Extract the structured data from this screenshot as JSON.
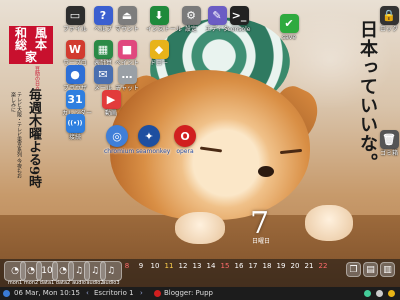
{
  "brand": {
    "title_chars": [
      "和",
      "風",
      "総",
      "本",
      "家"
    ],
    "subtitle": "豆助の日々",
    "schedule": "毎週木曜よる9時",
    "schedule_sub": "テレビ大阪・テレビ東京系列 今夜もお楽しみに"
  },
  "tagline": "日本っていいな。",
  "desktop_icons": [
    {
      "name": "file",
      "label": "ファイル",
      "glyph": "▭",
      "color": "#2d2d2d"
    },
    {
      "name": "help",
      "label": "ヘルプ",
      "glyph": "?",
      "color": "#3b5fd0"
    },
    {
      "name": "mount",
      "label": "マウント",
      "glyph": "⏏",
      "color": "#7d7d7d"
    },
    {
      "name": "install",
      "label": "インストール",
      "glyph": "⬇",
      "color": "#1f8a3b"
    },
    {
      "name": "settings",
      "label": "設定",
      "glyph": "⚙",
      "color": "#7a7a7a"
    },
    {
      "name": "editor",
      "label": "エディタ",
      "glyph": "✎",
      "color": "#6b5cc4"
    },
    {
      "name": "console",
      "label": "console",
      "glyph": ">_",
      "color": "#222"
    },
    {
      "name": "save",
      "label": "save",
      "glyph": "✔",
      "color": "#2faa3f"
    },
    {
      "name": "lock",
      "label": "ロック",
      "glyph": "🔒",
      "color": "#333"
    },
    {
      "name": "wordpro",
      "label": "ワープロ",
      "glyph": "W",
      "color": "#d23b2f"
    },
    {
      "name": "spreadsheet",
      "label": "表計算",
      "glyph": "▦",
      "color": "#2b8a46"
    },
    {
      "name": "paint",
      "label": "ペイント",
      "glyph": "■",
      "color": "#e0487e"
    },
    {
      "name": "draw",
      "label": "ドロー",
      "glyph": "◆",
      "color": "#e8b31a"
    },
    {
      "name": "browser",
      "label": "ブラウザ",
      "glyph": "●",
      "color": "#2e6fd6"
    },
    {
      "name": "mail",
      "label": "メール",
      "glyph": "✉",
      "color": "#4a6fb0"
    },
    {
      "name": "chat",
      "label": "チャット",
      "glyph": "…",
      "color": "#9aa0a6"
    },
    {
      "name": "calendar",
      "label": "カレンダー",
      "glyph": "31",
      "color": "#2f7fe0"
    },
    {
      "name": "video",
      "label": "動画",
      "glyph": "▶",
      "color": "#e23b3b"
    },
    {
      "name": "network",
      "label": "接続",
      "glyph": "((•))",
      "color": "#2f7fe0"
    },
    {
      "name": "chromium",
      "label": "chromium",
      "glyph": "◎",
      "color": "#3f7fd8"
    },
    {
      "name": "seamonkey",
      "label": "seamonkey",
      "glyph": "✦",
      "color": "#1e4fa0"
    },
    {
      "name": "opera",
      "label": "opera",
      "glyph": "O",
      "color": "#d11f1f"
    },
    {
      "name": "trash",
      "label": "ゴミ箱",
      "glyph": "🗑",
      "color": "#555"
    }
  ],
  "clock_widget": {
    "digit": "7",
    "sub": "日曜日"
  },
  "dock": {
    "items": [
      {
        "label": "mon1",
        "glyph": "◔"
      },
      {
        "label": "mon2",
        "glyph": "◔"
      },
      {
        "label": "data1",
        "glyph": "10"
      },
      {
        "label": "data2",
        "glyph": "◔"
      },
      {
        "label": "audio",
        "glyph": "♫"
      },
      {
        "label": "audio2",
        "glyph": "♫"
      },
      {
        "label": "audio3",
        "glyph": "♫"
      }
    ],
    "calendar_days": [
      "8",
      "9",
      "10",
      "11",
      "12",
      "13",
      "14",
      "15",
      "16",
      "17",
      "18",
      "19",
      "20",
      "21",
      "22"
    ],
    "calendar_highlight_today": "11",
    "calendar_sundays": [
      "8",
      "15",
      "22"
    ],
    "tray": [
      "❐",
      "▤",
      "▥"
    ]
  },
  "taskbar": {
    "datetime": "06 Mar, Mon 10:15",
    "workspace": "Escritorio 1",
    "task": "Blogger: Pupp"
  }
}
